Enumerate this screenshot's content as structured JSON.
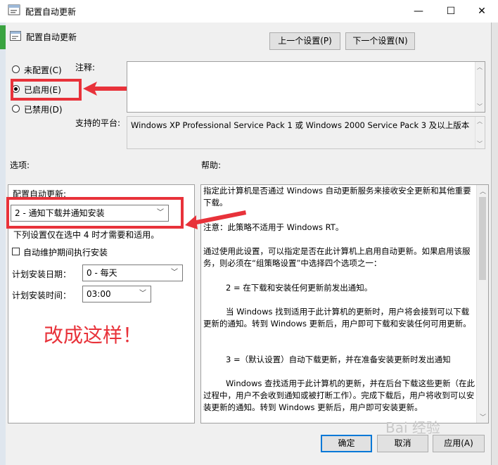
{
  "window": {
    "title": "配置自动更新",
    "minimize": "—",
    "maximize": "☐",
    "close": "✕"
  },
  "header": {
    "policy_name": "配置自动更新",
    "prev_button": "上一个设置(P)",
    "next_button": "下一个设置(N)"
  },
  "state": {
    "not_configured": "未配置(C)",
    "enabled": "已启用(E)",
    "disabled": "已禁用(D)",
    "selected": "enabled"
  },
  "comment": {
    "label": "注释:",
    "value": ""
  },
  "platforms": {
    "label": "支持的平台:",
    "value": "Windows XP Professional Service Pack 1 或 Windows 2000 Service Pack 3 及以上版本"
  },
  "sections": {
    "options": "选项:",
    "help": "帮助:"
  },
  "options": {
    "configure_label": "配置自动更新:",
    "configure_value": "2 - 通知下载并通知安装",
    "note": "下列设置仅在选中 4 时才需要和适用。",
    "maintenance_check": "自动维护期间执行安装",
    "day_label": "计划安装日期：",
    "day_value": "0 - 每天",
    "time_label": "计划安装时间：",
    "time_value": "03:00"
  },
  "help": {
    "p1": "指定此计算机是否通过 Windows 自动更新服务来接收安全更新和其他重要下载。",
    "p2": "注意：此策略不适用于 Windows RT。",
    "p3": "通过使用此设置，可以指定是否在此计算机上启用自动更新。如果启用该服务，则必须在“组策略设置”中选择四个选项之一：",
    "p4": "2 = 在下载和安装任何更新前发出通知。",
    "p5": "当 Windows 找到适用于此计算机的更新时，用户将会接到可以下载更新的通知。转到 Windows 更新后，用户即可下载和安装任何可用更新。",
    "p6": "3 =（默认设置）自动下载更新，并在准备安装更新时发出通知",
    "p7": "Windows 查找适用于此计算机的更新，并在后台下载这些更新（在此过程中，用户不会收到通知或被打断工作）。完成下载后，用户将收到可以安装更新的通知。转到 Windows 更新后，用户即可安装更新。"
  },
  "footer": {
    "ok": "确定",
    "cancel": "取消",
    "apply": "应用(A)"
  },
  "annotation": {
    "text": "改成这样！",
    "color": "#e8323a"
  },
  "watermark": {
    "text": "Bai 经验"
  }
}
